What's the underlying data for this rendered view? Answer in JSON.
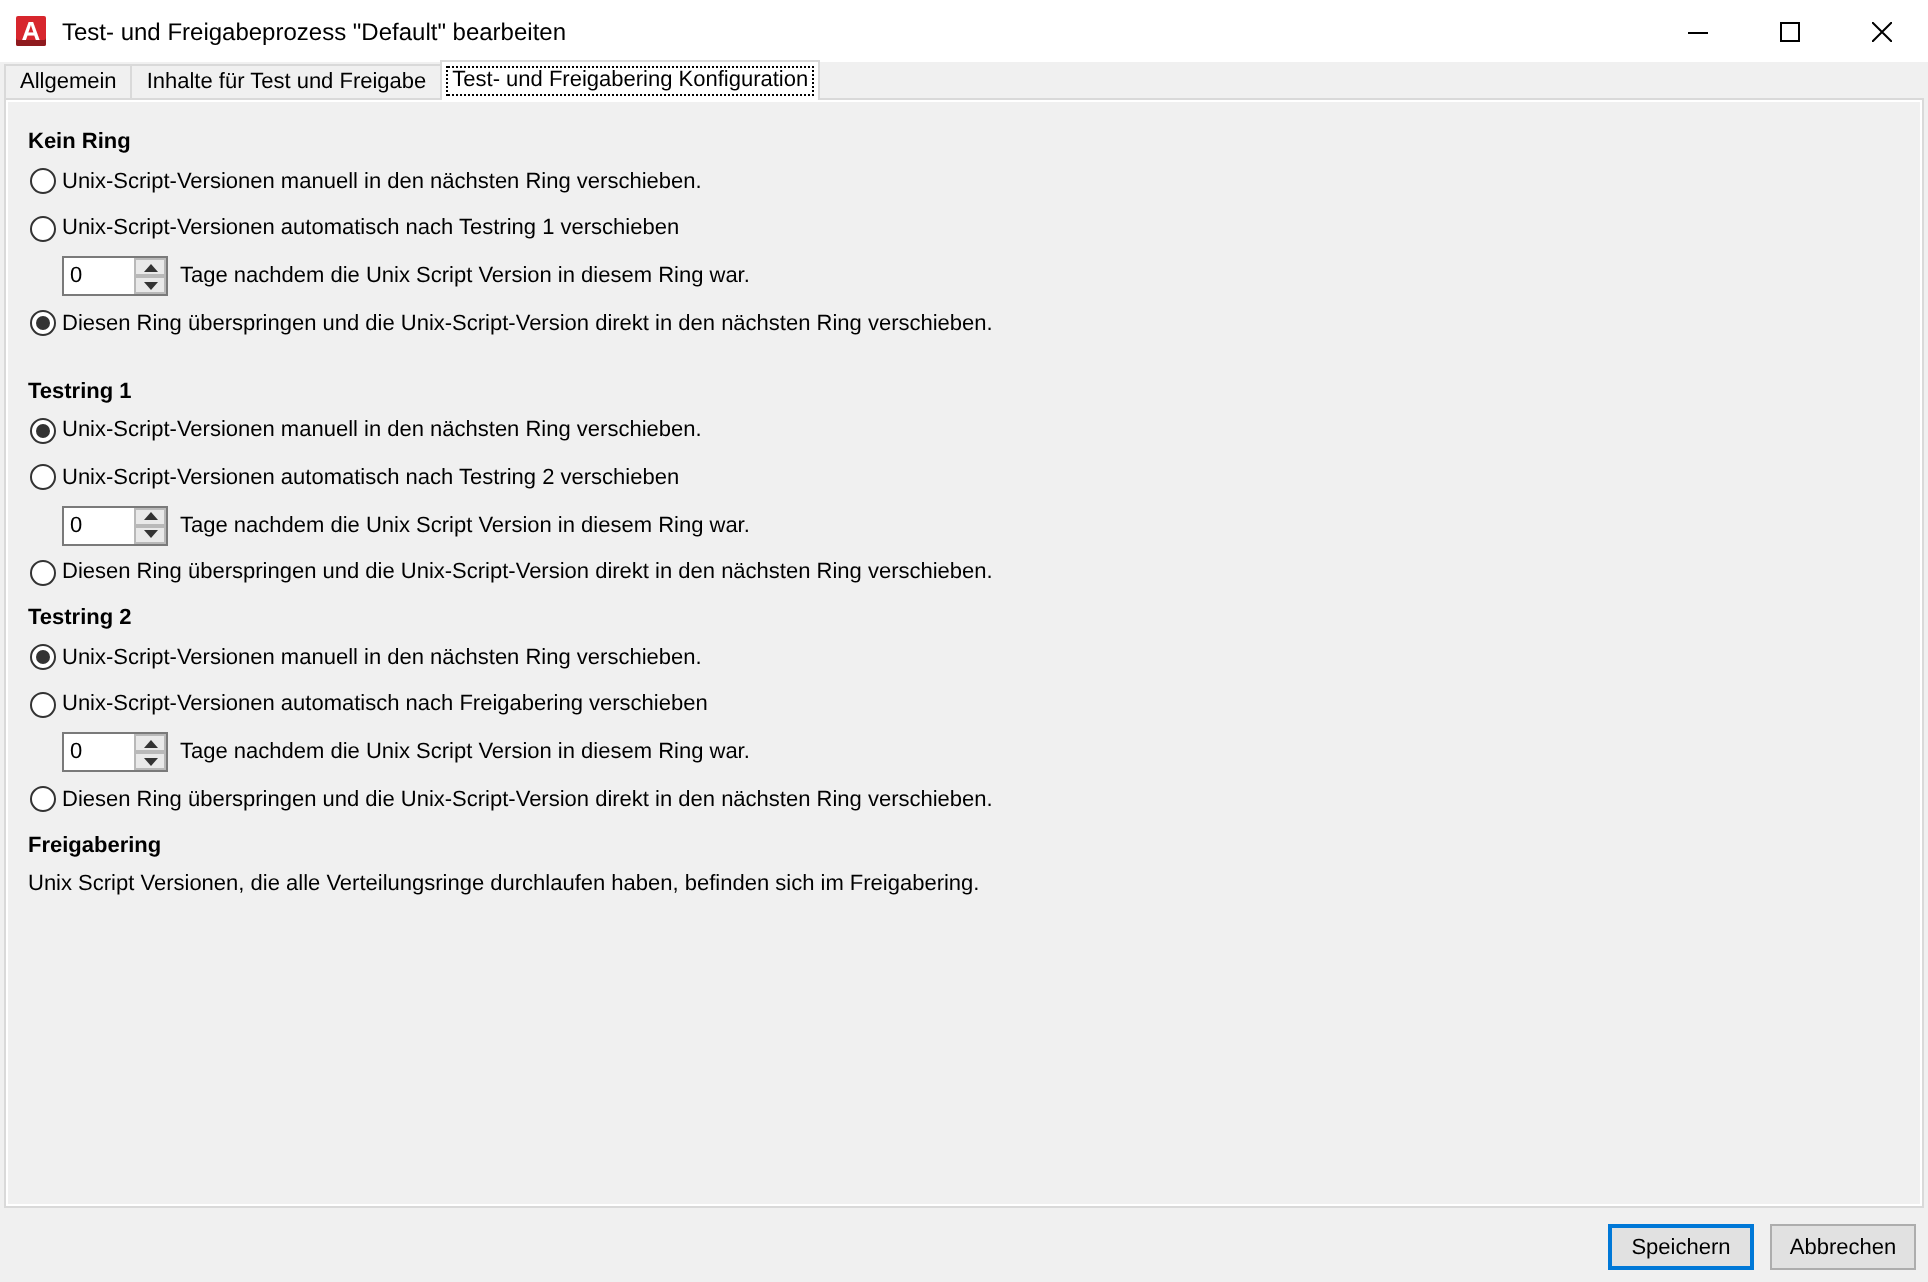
{
  "window": {
    "app_icon_letter": "A",
    "title": "Test- und Freigabeprozess \"Default\" bearbeiten"
  },
  "tabs": [
    {
      "label": "Allgemein",
      "selected": false
    },
    {
      "label": "Inhalte für Test und Freigabe",
      "selected": false
    },
    {
      "label": "Test- und Freigabering Konfiguration",
      "selected": true
    }
  ],
  "sections": [
    {
      "heading": "Kein Ring",
      "options": [
        {
          "label": "Unix-Script-Versionen manuell in den nächsten Ring verschieben.",
          "selected": false
        },
        {
          "label": "Unix-Script-Versionen automatisch nach Testring 1 verschieben",
          "selected": false,
          "delay": {
            "value": "0",
            "label": "Tage nachdem die Unix Script Version in diesem Ring war."
          }
        },
        {
          "label": "Diesen Ring überspringen und die Unix-Script-Version direkt in den nächsten Ring verschieben.",
          "selected": true
        }
      ]
    },
    {
      "heading": "Testring 1",
      "options": [
        {
          "label": "Unix-Script-Versionen manuell in den nächsten Ring verschieben.",
          "selected": true
        },
        {
          "label": "Unix-Script-Versionen automatisch nach Testring 2 verschieben",
          "selected": false,
          "delay": {
            "value": "0",
            "label": "Tage nachdem die Unix Script Version in diesem Ring war."
          }
        },
        {
          "label": "Diesen Ring überspringen und die Unix-Script-Version direkt in den nächsten Ring verschieben.",
          "selected": false
        }
      ]
    },
    {
      "heading": "Testring 2",
      "options": [
        {
          "label": "Unix-Script-Versionen manuell in den nächsten Ring verschieben.",
          "selected": true
        },
        {
          "label": "Unix-Script-Versionen automatisch nach Freigabering verschieben",
          "selected": false,
          "delay": {
            "value": "0",
            "label": "Tage nachdem die Unix Script Version in diesem Ring war."
          }
        },
        {
          "label": "Diesen Ring überspringen und die Unix-Script-Version direkt in den nächsten Ring verschieben.",
          "selected": false
        }
      ]
    },
    {
      "heading": "Freigabering",
      "text": "Unix Script Versionen, die alle Verteilungsringe durchlaufen haben, befinden sich im Freigabering."
    }
  ],
  "buttons": [
    {
      "label": "Speichern",
      "focused": true
    },
    {
      "label": "Abbrechen",
      "focused": false
    }
  ]
}
